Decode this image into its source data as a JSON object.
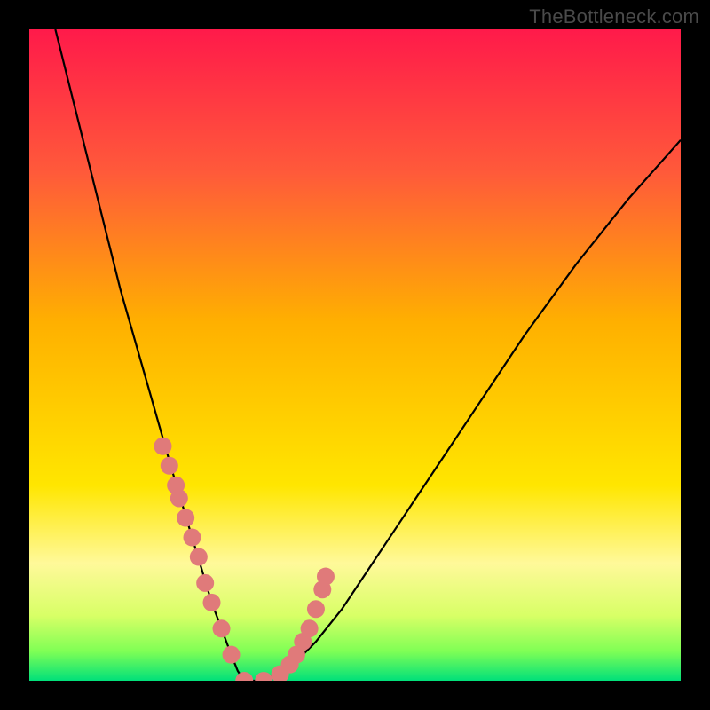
{
  "watermark": "TheBottleneck.com",
  "chart_data": {
    "type": "line",
    "title": "",
    "xlabel": "",
    "ylabel": "",
    "xlim": [
      0,
      100
    ],
    "ylim": [
      0,
      100
    ],
    "gradient_stops": [
      {
        "offset": 0,
        "color": "#ff1a4a"
      },
      {
        "offset": 0.22,
        "color": "#ff5a3a"
      },
      {
        "offset": 0.45,
        "color": "#ffb000"
      },
      {
        "offset": 0.7,
        "color": "#ffe600"
      },
      {
        "offset": 0.82,
        "color": "#fff99a"
      },
      {
        "offset": 0.9,
        "color": "#d8ff66"
      },
      {
        "offset": 0.955,
        "color": "#7fff55"
      },
      {
        "offset": 1.0,
        "color": "#00e07a"
      }
    ],
    "curve": {
      "x": [
        4,
        6,
        8,
        10,
        12,
        14,
        16,
        18,
        20,
        22,
        23.5,
        25,
        26.5,
        28,
        29.5,
        31,
        32,
        33,
        36,
        40,
        44,
        48,
        52,
        56,
        60,
        64,
        68,
        72,
        76,
        80,
        84,
        88,
        92,
        96,
        100
      ],
      "y": [
        100,
        92,
        84,
        76,
        68,
        60,
        53,
        46,
        39,
        32,
        27,
        22,
        17,
        12,
        8,
        4,
        1.5,
        0,
        0,
        2,
        6,
        11,
        17,
        23,
        29,
        35,
        41,
        47,
        53,
        58.5,
        64,
        69,
        74,
        78.5,
        83
      ]
    },
    "markers": {
      "x": [
        20.5,
        21.5,
        22.5,
        23.0,
        24.0,
        25.0,
        26.0,
        27.0,
        28.0,
        29.5,
        31.0,
        33.0,
        36.0,
        38.5,
        40.0,
        41.0,
        42.0,
        43.0,
        44.0,
        45.0,
        45.5
      ],
      "y": [
        36,
        33,
        30,
        28,
        25,
        22,
        19,
        15,
        12,
        8,
        4,
        0,
        0,
        1,
        2.5,
        4,
        6,
        8,
        11,
        14,
        16
      ],
      "color": "#e07a7a",
      "r": 10
    }
  }
}
